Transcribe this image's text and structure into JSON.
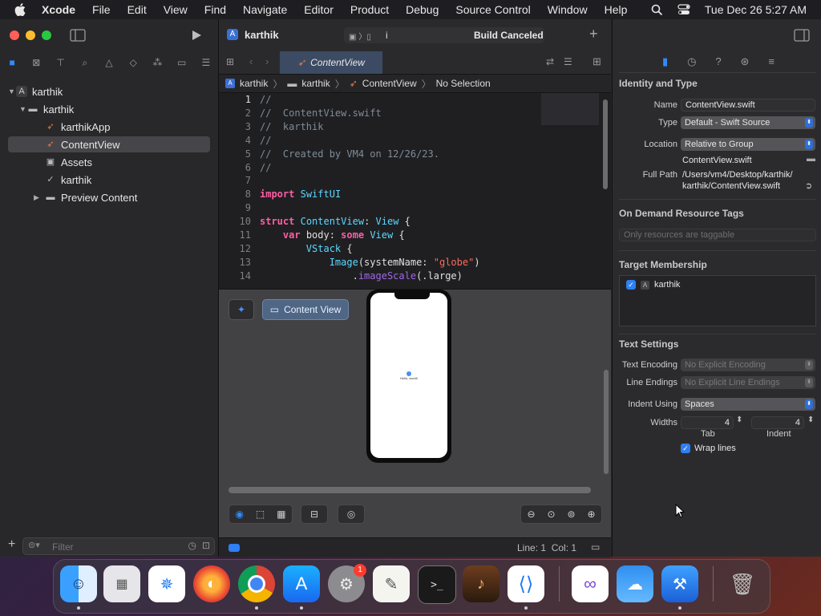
{
  "menubar": {
    "app": "Xcode",
    "items": [
      "File",
      "Edit",
      "View",
      "Find",
      "Navigate",
      "Editor",
      "Product",
      "Debug",
      "Source Control",
      "Window",
      "Help"
    ],
    "clock": "Tue Dec 26  5:27 AM"
  },
  "toolbar": {
    "project": "karthik",
    "scheme_device": "i",
    "build_status": "Build Canceled"
  },
  "navigator": {
    "tree": [
      "karthik",
      "karthik",
      "karthikApp",
      "ContentView",
      "Assets",
      "karthik",
      "Preview Content"
    ],
    "selected": "ContentView",
    "filter_placeholder": "Filter"
  },
  "editor": {
    "tab": "ContentView",
    "jumpbar": [
      "karthik",
      "karthik",
      "ContentView",
      "No Selection"
    ],
    "code_lines": [
      {
        "n": "1",
        "t": "//"
      },
      {
        "n": "2",
        "t": "//  ContentView.swift"
      },
      {
        "n": "3",
        "t": "//  karthik"
      },
      {
        "n": "4",
        "t": "//"
      },
      {
        "n": "5",
        "t": "//  Created by VM4 on 12/26/23."
      },
      {
        "n": "6",
        "t": "//"
      },
      {
        "n": "7",
        "t": ""
      },
      {
        "n": "8",
        "t": "import SwiftUI"
      },
      {
        "n": "9",
        "t": ""
      },
      {
        "n": "10",
        "t": "struct ContentView: View {"
      },
      {
        "n": "11",
        "t": "    var body: some View {"
      },
      {
        "n": "12",
        "t": "        VStack {"
      },
      {
        "n": "13",
        "t": "            Image(systemName: \"globe\")"
      },
      {
        "n": "14",
        "t": "                .imageScale(.large)"
      }
    ]
  },
  "canvas": {
    "preview_button": "Content View",
    "phone_text": "Hello, world!"
  },
  "status": {
    "cursor": "Line: 1  Col: 1"
  },
  "inspector": {
    "identity_title": "Identity and Type",
    "name_label": "Name",
    "name_value": "ContentView.swift",
    "type_label": "Type",
    "type_value": "Default - Swift Source",
    "location_label": "Location",
    "location_value": "Relative to Group",
    "location_file": "ContentView.swift",
    "fullpath_label": "Full Path",
    "fullpath_line1": "/Users/vm4/Desktop/karthik/",
    "fullpath_line2": "karthik/ContentView.swift",
    "tags_title": "On Demand Resource Tags",
    "tags_placeholder": "Only resources are taggable",
    "target_title": "Target Membership",
    "target_item": "karthik",
    "text_title": "Text Settings",
    "encoding_label": "Text Encoding",
    "encoding_value": "No Explicit Encoding",
    "endings_label": "Line Endings",
    "endings_value": "No Explicit Line Endings",
    "indent_label": "Indent Using",
    "indent_value": "Spaces",
    "widths_label": "Widths",
    "tab_value": "4",
    "tab_caption": "Tab",
    "indent_width_value": "4",
    "indent_caption": "Indent",
    "wrap_label": "Wrap lines"
  },
  "dock": {
    "apps": [
      "Finder",
      "Launchpad",
      "Safari",
      "Firefox",
      "Chrome",
      "App Store",
      "System Settings",
      "TextEdit",
      "Terminal",
      "Instruments",
      "Visual Studio Code",
      "Visual Studio",
      "Weather",
      "Xcode",
      "Trash"
    ],
    "settings_badge": "1"
  }
}
